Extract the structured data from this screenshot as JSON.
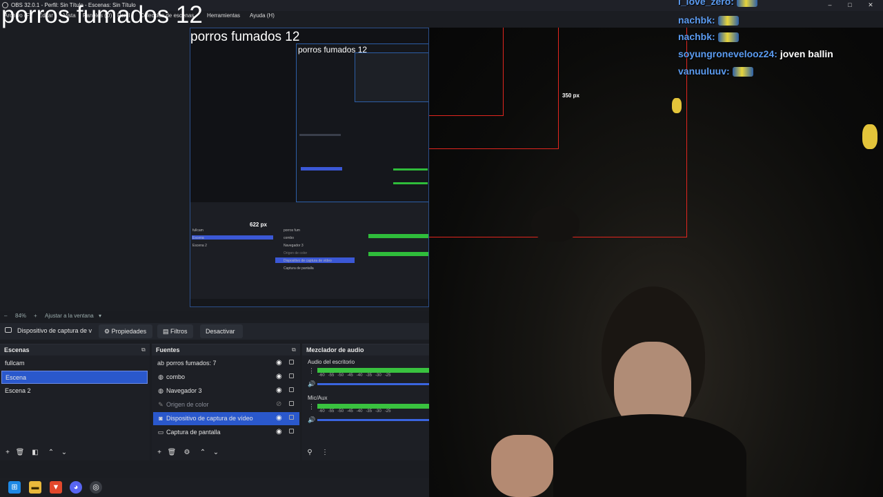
{
  "window": {
    "title": "OBS 32.0.1 - Perfil: Sin Título - Escenas: Sin Título",
    "controls": [
      "–",
      "□",
      "✕"
    ]
  },
  "menu": [
    "Archivo (F)",
    "Editar",
    "Vista",
    "Paneles (D)",
    "Perfil",
    "Colección de escenas",
    "Herramientas",
    "Ayuda (H)"
  ],
  "overlay": {
    "title": "porros fumados 12"
  },
  "preview": {
    "nested_title": "porros fumados 12",
    "nested_title_small": "porros fumados 12",
    "px_label_1": "622 px",
    "px_label_2": "350 px",
    "nested_sources": [
      "porros fum",
      "combo",
      "Navegador 3",
      "Origen de color",
      "Dispositivo de captura de vídeo",
      "Captura de pantalla"
    ],
    "nested_scenes": [
      "fullcam",
      "Escena",
      "Escena 2"
    ]
  },
  "zoom": {
    "level": "84%",
    "fit": "Ajustar a la ventana"
  },
  "context": {
    "source_name": "Dispositivo de captura de v",
    "properties": "Propiedades",
    "filters": "Filtros",
    "deactivate": "Desactivar"
  },
  "scenes": {
    "title": "Escenas",
    "items": [
      {
        "label": "fullcam",
        "selected": false
      },
      {
        "label": "Escena",
        "selected": true
      },
      {
        "label": "Escena 2",
        "selected": false
      }
    ]
  },
  "sources": {
    "title": "Fuentes",
    "items": [
      {
        "label": "porros fumados: 7",
        "icon": "text-icon",
        "selected": false,
        "dim": false
      },
      {
        "label": "combo",
        "icon": "globe-icon",
        "selected": false,
        "dim": false
      },
      {
        "label": "Navegador 3",
        "icon": "globe-icon",
        "selected": false,
        "dim": false
      },
      {
        "label": "Origen de color",
        "icon": "brush-icon",
        "selected": false,
        "dim": true
      },
      {
        "label": "Dispositivo de captura de vídeo",
        "icon": "camera-icon",
        "selected": true,
        "dim": false
      },
      {
        "label": "Captura de pantalla",
        "icon": "monitor-icon",
        "selected": false,
        "dim": false
      }
    ]
  },
  "mixer": {
    "title": "Mezclador de audio",
    "channels": [
      {
        "label": "Audio del escritorio",
        "level": 1.0
      },
      {
        "label": "Mic/Aux",
        "level": 1.0
      }
    ],
    "scale": [
      "-60",
      "-55",
      "-50",
      "-45",
      "-40",
      "-35",
      "-30",
      "-25"
    ]
  },
  "chat": [
    {
      "name": "i_love_zero:",
      "message": ""
    },
    {
      "name": "nachbk:",
      "message": ""
    },
    {
      "name": "nachbk:",
      "message": ""
    },
    {
      "name": "soyungronevelooz24:",
      "message": "joven ballin"
    },
    {
      "name": "vanuuluuv:",
      "message": ""
    }
  ],
  "colors": {
    "accent": "#2a58cc",
    "frame_red": "#e3261f",
    "meter_green": "#39c23f",
    "chat_name": "#5b9bf0"
  },
  "taskbar": [
    "windows-icon",
    "folder-icon",
    "brave-icon",
    "discord-icon",
    "obs-icon"
  ]
}
